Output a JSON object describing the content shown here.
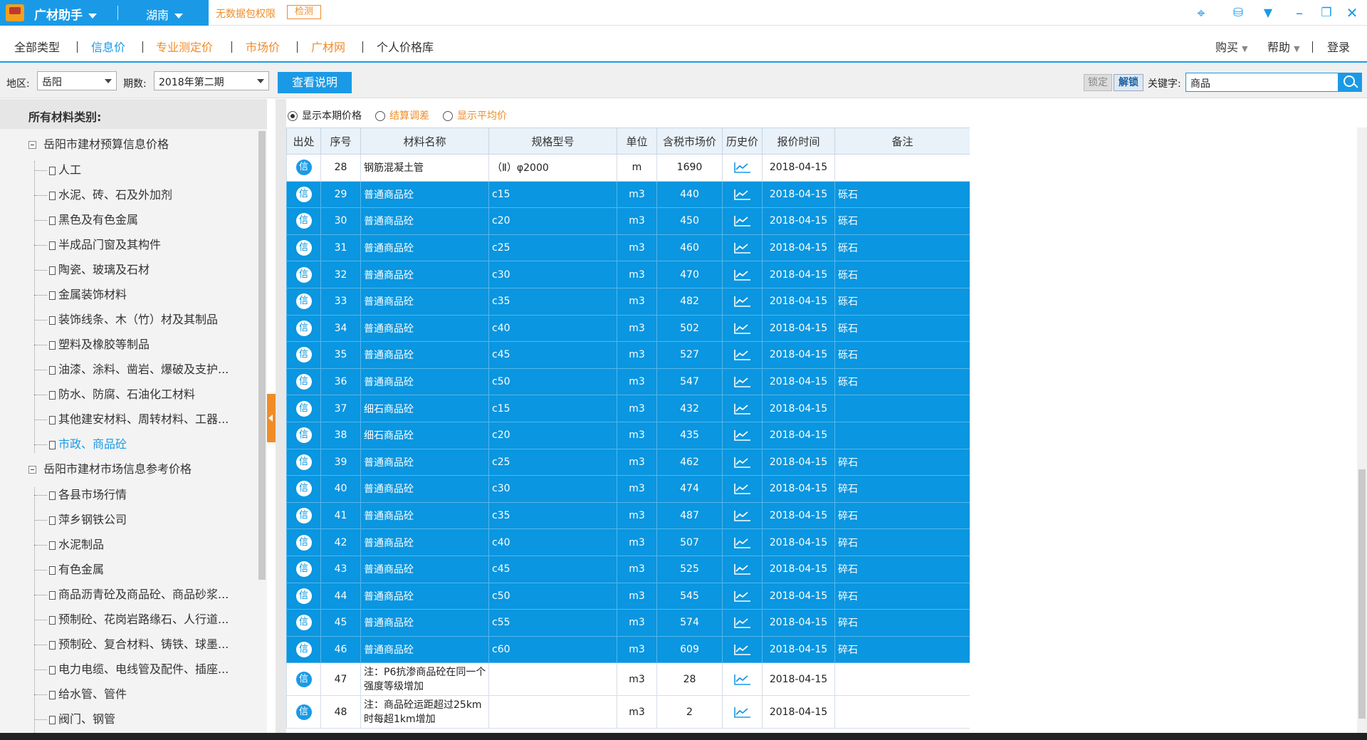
{
  "topbar": {
    "app_name": "广材助手",
    "region": "湖南",
    "no_data_text": "无数据包权限",
    "check_button": "检测",
    "icons": [
      "crosshair-icon",
      "database-icon",
      "download-icon",
      "minimize-icon",
      "restore-icon",
      "close-icon"
    ]
  },
  "nav": {
    "items": [
      {
        "label": "全部类型"
      },
      {
        "label": "信息价"
      },
      {
        "label": "专业测定价"
      },
      {
        "label": "市场价"
      },
      {
        "label": "广材网"
      },
      {
        "label": "个人价格库"
      }
    ],
    "right": {
      "buy": "购买",
      "help": "帮助",
      "login": "登录"
    }
  },
  "filter": {
    "region_label": "地区:",
    "region_value": "岳阳",
    "period_label": "期数:",
    "period_value": "2018年第二期",
    "view_button": "查看说明",
    "lock_button": "锁定",
    "unlock_button": "解锁",
    "keyword_label": "关键字:",
    "keyword_value": "商品"
  },
  "sidebar": {
    "title": "所有材料类别:",
    "group1": {
      "label": "岳阳市建材预算信息价格",
      "items": [
        "人工",
        "水泥、砖、石及外加剂",
        "黑色及有色金属",
        "半成品门窗及其构件",
        "陶瓷、玻璃及石材",
        "金属装饰材料",
        "装饰线条、木（竹）材及其制品",
        "塑料及橡胶等制品",
        "油漆、涂料、凿岩、爆破及支护...",
        "防水、防腐、石油化工材料",
        "其他建安材料、周转材料、工器...",
        "市政、商品砼"
      ]
    },
    "group2": {
      "label": "岳阳市建材市场信息参考价格",
      "items": [
        "各县市场行情",
        "萍乡钢铁公司",
        "水泥制品",
        "有色金属",
        "商品沥青砼及商品砼、商品砂浆...",
        "预制砼、花岗岩路缘石、人行道...",
        "预制砼、复合材料、铸铁、球墨...",
        "电力电缆、电线管及配件、插座...",
        "给水管、管件",
        "阀门、钢管"
      ]
    }
  },
  "options": {
    "show_current": "显示本期价格",
    "settlement": "结算调差",
    "show_average": "显示平均价"
  },
  "table": {
    "headers": [
      "出处",
      "序号",
      "材料名称",
      "规格型号",
      "单位",
      "含税市场价",
      "历史价",
      "报价时间",
      "备注"
    ],
    "badge": "信",
    "rows": [
      {
        "no": "28",
        "name": "钢筋混凝土管",
        "spec": "（Ⅱ）φ2000",
        "unit": "m",
        "price": "1690",
        "date": "2018-04-15",
        "note": "",
        "sel": false
      },
      {
        "no": "29",
        "name": "普通商品砼",
        "spec": "c15",
        "unit": "m3",
        "price": "440",
        "date": "2018-04-15",
        "note": "砾石",
        "sel": true
      },
      {
        "no": "30",
        "name": "普通商品砼",
        "spec": "c20",
        "unit": "m3",
        "price": "450",
        "date": "2018-04-15",
        "note": "砾石",
        "sel": true
      },
      {
        "no": "31",
        "name": "普通商品砼",
        "spec": "c25",
        "unit": "m3",
        "price": "460",
        "date": "2018-04-15",
        "note": "砾石",
        "sel": true
      },
      {
        "no": "32",
        "name": "普通商品砼",
        "spec": "c30",
        "unit": "m3",
        "price": "470",
        "date": "2018-04-15",
        "note": "砾石",
        "sel": true
      },
      {
        "no": "33",
        "name": "普通商品砼",
        "spec": "c35",
        "unit": "m3",
        "price": "482",
        "date": "2018-04-15",
        "note": "砾石",
        "sel": true
      },
      {
        "no": "34",
        "name": "普通商品砼",
        "spec": "c40",
        "unit": "m3",
        "price": "502",
        "date": "2018-04-15",
        "note": "砾石",
        "sel": true
      },
      {
        "no": "35",
        "name": "普通商品砼",
        "spec": "c45",
        "unit": "m3",
        "price": "527",
        "date": "2018-04-15",
        "note": "砾石",
        "sel": true
      },
      {
        "no": "36",
        "name": "普通商品砼",
        "spec": "c50",
        "unit": "m3",
        "price": "547",
        "date": "2018-04-15",
        "note": "砾石",
        "sel": true
      },
      {
        "no": "37",
        "name": "细石商品砼",
        "spec": "c15",
        "unit": "m3",
        "price": "432",
        "date": "2018-04-15",
        "note": "",
        "sel": true
      },
      {
        "no": "38",
        "name": "细石商品砼",
        "spec": "c20",
        "unit": "m3",
        "price": "435",
        "date": "2018-04-15",
        "note": "",
        "sel": true
      },
      {
        "no": "39",
        "name": "普通商品砼",
        "spec": "c25",
        "unit": "m3",
        "price": "462",
        "date": "2018-04-15",
        "note": "碎石",
        "sel": true
      },
      {
        "no": "40",
        "name": "普通商品砼",
        "spec": "c30",
        "unit": "m3",
        "price": "474",
        "date": "2018-04-15",
        "note": "碎石",
        "sel": true
      },
      {
        "no": "41",
        "name": "普通商品砼",
        "spec": "c35",
        "unit": "m3",
        "price": "487",
        "date": "2018-04-15",
        "note": "碎石",
        "sel": true
      },
      {
        "no": "42",
        "name": "普通商品砼",
        "spec": "c40",
        "unit": "m3",
        "price": "507",
        "date": "2018-04-15",
        "note": "碎石",
        "sel": true
      },
      {
        "no": "43",
        "name": "普通商品砼",
        "spec": "c45",
        "unit": "m3",
        "price": "525",
        "date": "2018-04-15",
        "note": "碎石",
        "sel": true
      },
      {
        "no": "44",
        "name": "普通商品砼",
        "spec": "c50",
        "unit": "m3",
        "price": "545",
        "date": "2018-04-15",
        "note": "碎石",
        "sel": true
      },
      {
        "no": "45",
        "name": "普通商品砼",
        "spec": "c55",
        "unit": "m3",
        "price": "574",
        "date": "2018-04-15",
        "note": "碎石",
        "sel": true
      },
      {
        "no": "46",
        "name": "普通商品砼",
        "spec": "c60",
        "unit": "m3",
        "price": "609",
        "date": "2018-04-15",
        "note": "碎石",
        "sel": true
      },
      {
        "no": "47",
        "name": "注：P6抗渗商品砼在同一个强度等级增加",
        "spec": "",
        "unit": "m3",
        "price": "28",
        "date": "2018-04-15",
        "note": "",
        "sel": false,
        "tall": true
      },
      {
        "no": "48",
        "name": "注：商品砼运距超过25km时每超1km增加",
        "spec": "",
        "unit": "m3",
        "price": "2",
        "date": "2018-04-15",
        "note": "",
        "sel": false,
        "tall": true
      }
    ]
  },
  "colors": {
    "accent": "#1a9ae6",
    "selected_row": "#0a96e0",
    "orange": "#f08c28"
  }
}
